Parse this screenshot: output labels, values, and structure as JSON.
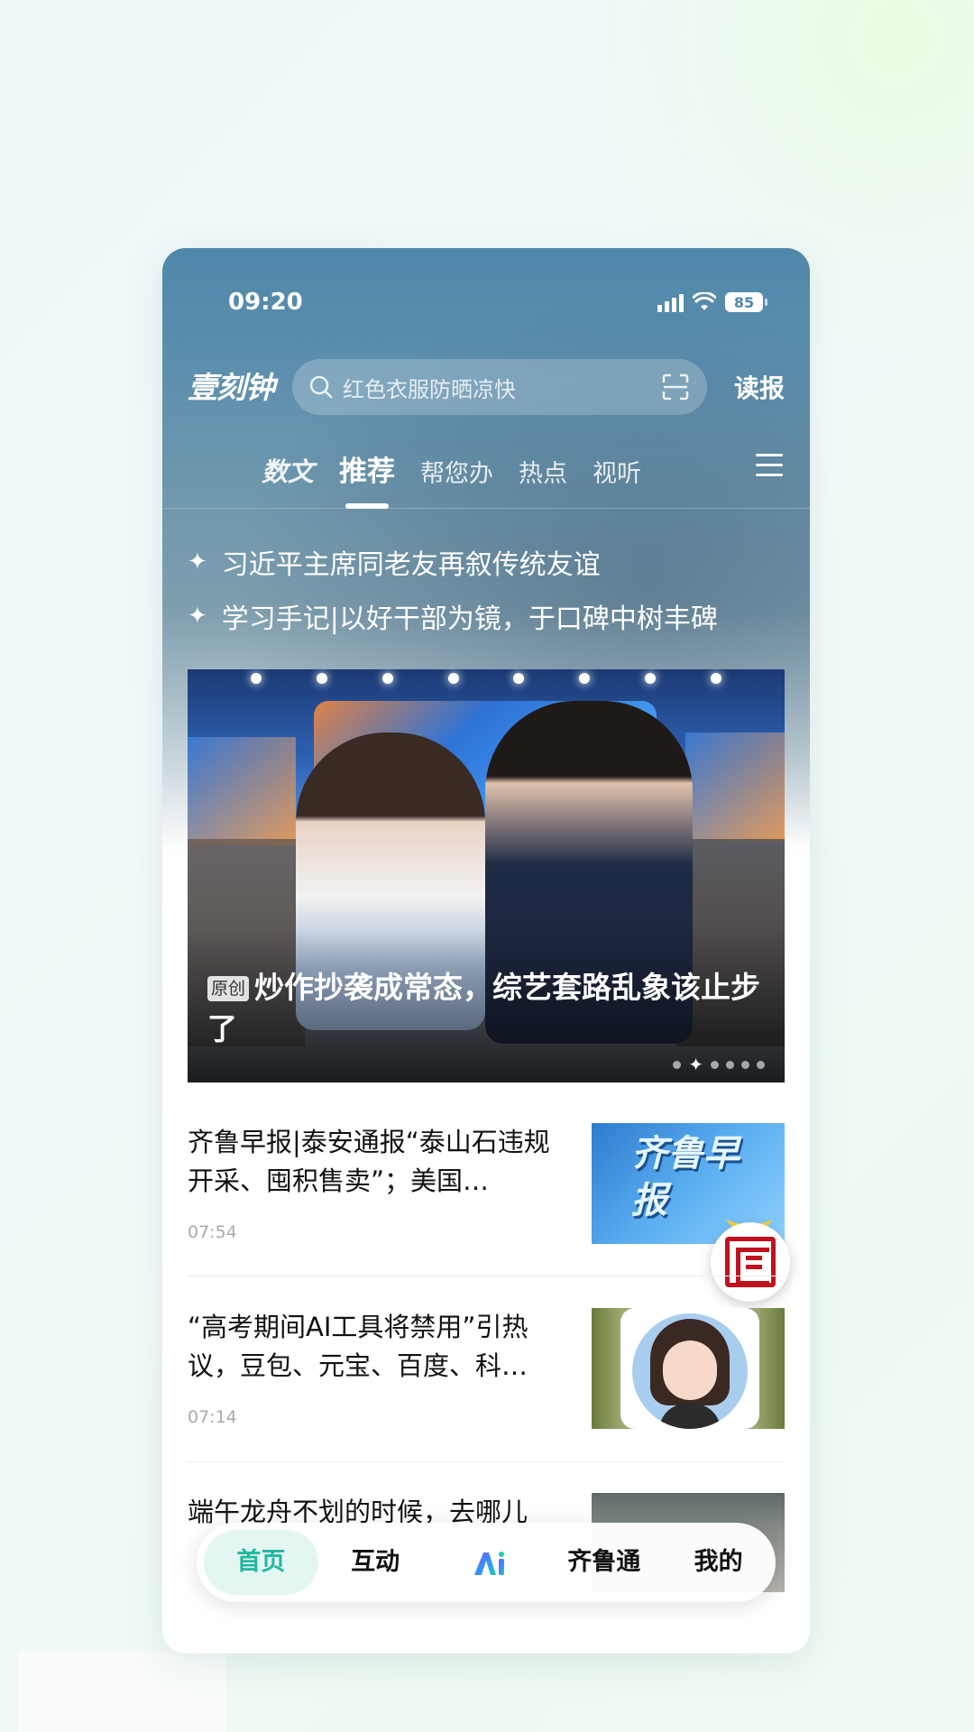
{
  "status_bar": {
    "time": "09:20",
    "battery": "85"
  },
  "header": {
    "logo": "壹刻钟",
    "search_placeholder": "红色衣服防晒凉快",
    "read_paper": "读报"
  },
  "tabs": [
    {
      "label": "数文"
    },
    {
      "label": "推荐"
    },
    {
      "label": "帮您办"
    },
    {
      "label": "热点"
    },
    {
      "label": "视听"
    }
  ],
  "headlines": [
    {
      "text": "习近平主席同老友再叙传统友谊"
    },
    {
      "text": "学习手记|以好干部为镜，于口碑中树丰碑"
    }
  ],
  "banner": {
    "badge": "原创",
    "title": "炒作抄袭成常态，综艺套路乱象该止步了",
    "dot_count": 6,
    "active_dot": 2
  },
  "feed": [
    {
      "title": "齐鲁早报|泰安通报“泰山石违规开采、囤积售卖”；美国…",
      "time": "07:54",
      "thumb_text": "齐鲁早报"
    },
    {
      "title": "“高考期间AI工具将禁用”引热议，豆包、元宝、百度、科…",
      "time": "07:14"
    },
    {
      "title": "端午龙舟不划的时候，去哪儿"
    }
  ],
  "bottom_nav": [
    {
      "label": "首页"
    },
    {
      "label": "互动"
    },
    {
      "label": "AI",
      "icon": "ai-logo-icon"
    },
    {
      "label": "齐鲁通"
    },
    {
      "label": "我的"
    }
  ],
  "colors": {
    "accent": "#1fb8a0",
    "header_blue": "#4f87a9",
    "seal_red": "#c0121e"
  }
}
